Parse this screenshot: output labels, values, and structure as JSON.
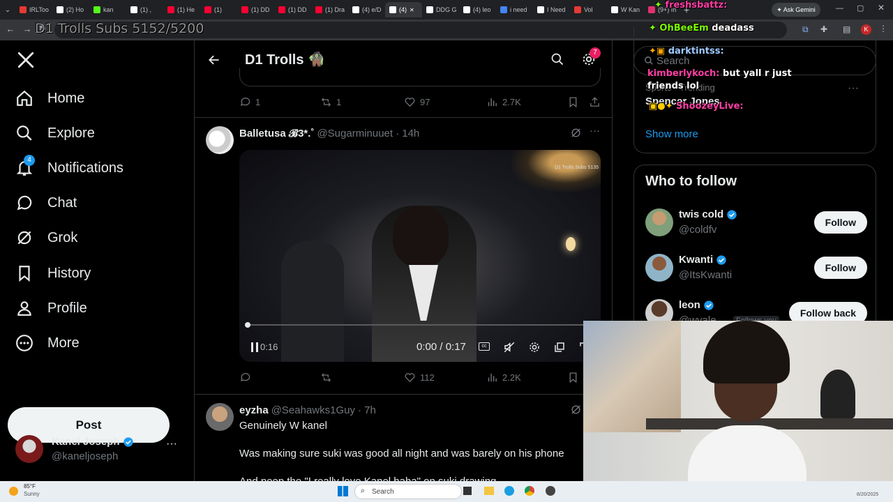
{
  "browser": {
    "tabs": [
      {
        "label": "IRLToo",
        "color": "#e53935"
      },
      {
        "label": "(2) Ho",
        "color": "#ffffff"
      },
      {
        "label": "kan",
        "color": "#53fc18"
      },
      {
        "label": "(1) ,",
        "color": "#ffffff"
      },
      {
        "label": "(1) He",
        "color": "#ff0033"
      },
      {
        "label": "(1) ",
        "color": "#ff0033"
      },
      {
        "label": "(1) DD",
        "color": "#ff0033"
      },
      {
        "label": "(1) DD",
        "color": "#ff0033"
      },
      {
        "label": "(1) Dra",
        "color": "#ff0033"
      },
      {
        "label": "(4) e/D",
        "color": "#ffffff"
      },
      {
        "label": "(4)",
        "color": "#ffffff",
        "active": true
      },
      {
        "label": "DDG G",
        "color": "#ffffff"
      },
      {
        "label": "(4) leo",
        "color": "#ffffff"
      },
      {
        "label": "i need",
        "color": "#4285f4"
      },
      {
        "label": "I Need",
        "color": "#ffffff"
      },
      {
        "label": "Vol",
        "color": "#e53935"
      },
      {
        "label": "W Kan",
        "color": "#ffffff"
      },
      {
        "label": "(9+) In",
        "color": "#e1306c"
      }
    ],
    "ask_gemini": "Ask Gemini",
    "profile_initial": "K"
  },
  "stream_overlay": {
    "subs_counter": "D1 Trolls Subs 5152/5200",
    "chat": [
      {
        "user": "freshsbattz:",
        "text": ""
      },
      {
        "user": "OhBeeEm",
        "text": "deadass"
      },
      {
        "user": "darktintss:",
        "text": ""
      },
      {
        "user": "kimberlykoch:",
        "text": "but yall r just friends lol"
      },
      {
        "user": "ShoozeyLive:",
        "text": ""
      }
    ]
  },
  "leftnav": {
    "items": [
      {
        "label": "Home",
        "icon": "home-icon"
      },
      {
        "label": "Explore",
        "icon": "search-icon"
      },
      {
        "label": "Notifications",
        "icon": "bell-icon",
        "badge": "4"
      },
      {
        "label": "Chat",
        "icon": "chat-icon"
      },
      {
        "label": "Grok",
        "icon": "grok-icon"
      },
      {
        "label": "History",
        "icon": "bookmark-icon"
      },
      {
        "label": "Profile",
        "icon": "person-icon"
      },
      {
        "label": "More",
        "icon": "more-circle-icon"
      }
    ],
    "post_label": "Post",
    "account": {
      "name": "Kanel Joseph",
      "handle": "@kaneljoseph"
    }
  },
  "header": {
    "title": "D1 Trolls 🧌",
    "settings_badge": "7"
  },
  "prev_post_actions": {
    "replies": "1",
    "reposts": "1",
    "likes": "97",
    "views": "2.7K"
  },
  "post1": {
    "name": "Balletusa 𝓑3*.˚",
    "handle": "@Sugarminuuet",
    "time": "· 14h",
    "video_watermark": "D1 Trolls Subs 5135",
    "video_time_left": "0:16",
    "video_time": "0:00 / 0:17",
    "video_progress": 0.0,
    "actions": {
      "replies": "",
      "reposts": "",
      "likes": "112",
      "views": "2.2K"
    }
  },
  "post2": {
    "name": "eyzha",
    "handle": "@Seahawks1Guy",
    "time": "· 7h",
    "line1": "Genuinely W kanel",
    "line2": "Was making sure suki was good all night and was barely on his phone",
    "line3": "And peep the \"I really love Kanel haha\" on suki drawing"
  },
  "trending": {
    "search_placeholder": "Search",
    "context": "Sports · Trending",
    "topic": "Spencer Jones",
    "show_more": "Show more"
  },
  "who_to_follow": {
    "title": "Who to follow",
    "accounts": [
      {
        "name": "twis cold",
        "handle": "@coldfv",
        "button": "Follow"
      },
      {
        "name": "Kwanti",
        "handle": "@ItsKwanti",
        "button": "Follow"
      },
      {
        "name": "leon",
        "handle": "@wvale",
        "button": "Follow back",
        "follows_you": "Follows you"
      }
    ]
  },
  "taskbar": {
    "weather_temp": "85°F",
    "weather_desc": "Sunny",
    "search_placeholder": "Search",
    "date": "8/20/2025"
  }
}
